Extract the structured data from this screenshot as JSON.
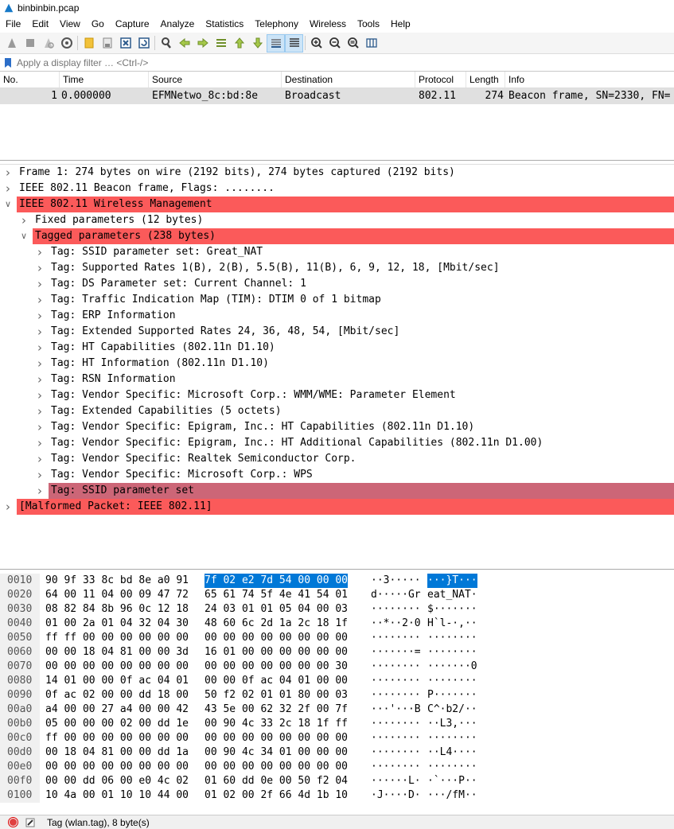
{
  "window": {
    "title": "binbinbin.pcap",
    "icon": "wireshark-fin-icon"
  },
  "menu": [
    "File",
    "Edit",
    "View",
    "Go",
    "Capture",
    "Analyze",
    "Statistics",
    "Telephony",
    "Wireless",
    "Tools",
    "Help"
  ],
  "toolbar_icons": [
    "start-capture-icon",
    "stop-capture-icon",
    "restart-capture-icon",
    "capture-options-icon",
    "open-file-icon",
    "save-file-icon",
    "close-file-icon",
    "reload-file-icon",
    "find-packet-icon",
    "go-back-icon",
    "go-forward-icon",
    "go-to-packet-icon",
    "go-first-icon",
    "go-last-icon",
    "autoscroll-icon",
    "colorize-icon",
    "zoom-in-icon",
    "zoom-out-icon",
    "zoom-normal-icon",
    "resize-columns-icon"
  ],
  "filter": {
    "placeholder": "Apply a display filter … <Ctrl-/>"
  },
  "packet_list": {
    "columns": [
      "No.",
      "Time",
      "Source",
      "Destination",
      "Protocol",
      "Length",
      "Info"
    ],
    "rows": [
      {
        "no": "1",
        "time": "0.000000",
        "source": "EFMNetwo_8c:bd:8e",
        "destination": "Broadcast",
        "protocol": "802.11",
        "length": "274",
        "info": "Beacon frame, SN=2330, FN="
      }
    ]
  },
  "details": [
    {
      "text": "Frame 1: 274 bytes on wire (2192 bits), 274 bytes captured (2192 bits)",
      "level": 0,
      "expanded": false,
      "style": "normal"
    },
    {
      "text": "IEEE 802.11 Beacon frame, Flags: ........",
      "level": 0,
      "expanded": false,
      "style": "normal"
    },
    {
      "text": "IEEE 802.11 Wireless Management",
      "level": 0,
      "expanded": true,
      "style": "red"
    },
    {
      "text": "Fixed parameters (12 bytes)",
      "level": 1,
      "expanded": false,
      "style": "normal"
    },
    {
      "text": "Tagged parameters (238 bytes)",
      "level": 1,
      "expanded": true,
      "style": "red"
    },
    {
      "text": "Tag: SSID parameter set: Great_NAT",
      "level": 2,
      "expanded": false,
      "style": "normal"
    },
    {
      "text": "Tag: Supported Rates 1(B), 2(B), 5.5(B), 11(B), 6, 9, 12, 18, [Mbit/sec]",
      "level": 2,
      "expanded": false,
      "style": "normal"
    },
    {
      "text": "Tag: DS Parameter set: Current Channel: 1",
      "level": 2,
      "expanded": false,
      "style": "normal"
    },
    {
      "text": "Tag: Traffic Indication Map (TIM): DTIM 0 of 1 bitmap",
      "level": 2,
      "expanded": false,
      "style": "normal"
    },
    {
      "text": "Tag: ERP Information",
      "level": 2,
      "expanded": false,
      "style": "normal"
    },
    {
      "text": "Tag: Extended Supported Rates 24, 36, 48, 54, [Mbit/sec]",
      "level": 2,
      "expanded": false,
      "style": "normal"
    },
    {
      "text": "Tag: HT Capabilities (802.11n D1.10)",
      "level": 2,
      "expanded": false,
      "style": "normal"
    },
    {
      "text": "Tag: HT Information (802.11n D1.10)",
      "level": 2,
      "expanded": false,
      "style": "normal"
    },
    {
      "text": "Tag: RSN Information",
      "level": 2,
      "expanded": false,
      "style": "normal"
    },
    {
      "text": "Tag: Vendor Specific: Microsoft Corp.: WMM/WME: Parameter Element",
      "level": 2,
      "expanded": false,
      "style": "normal"
    },
    {
      "text": "Tag: Extended Capabilities (5 octets)",
      "level": 2,
      "expanded": false,
      "style": "normal"
    },
    {
      "text": "Tag: Vendor Specific: Epigram, Inc.: HT Capabilities (802.11n D1.10)",
      "level": 2,
      "expanded": false,
      "style": "normal"
    },
    {
      "text": "Tag: Vendor Specific: Epigram, Inc.: HT Additional Capabilities (802.11n D1.00)",
      "level": 2,
      "expanded": false,
      "style": "normal"
    },
    {
      "text": "Tag: Vendor Specific: Realtek Semiconductor Corp.",
      "level": 2,
      "expanded": false,
      "style": "normal"
    },
    {
      "text": "Tag: Vendor Specific: Microsoft Corp.: WPS",
      "level": 2,
      "expanded": false,
      "style": "normal"
    },
    {
      "text": "Tag: SSID parameter set",
      "level": 2,
      "expanded": false,
      "style": "selected"
    },
    {
      "text": "[Malformed Packet: IEEE 802.11]",
      "level": 0,
      "expanded": false,
      "style": "red"
    }
  ],
  "hex_rows": [
    {
      "offset": "0010",
      "b1": "90 9f 33 8c bd 8e a0 91",
      "b2": "7f 02 e2 7d 54 00 00 00",
      "a1": "··3·····",
      "a2": "···}T···",
      "hl_b2": true
    },
    {
      "offset": "0020",
      "b1": "64 00 11 04 00 09 47 72",
      "b2": "65 61 74 5f 4e 41 54 01",
      "a1": "d·····Gr",
      "a2": "eat_NAT·"
    },
    {
      "offset": "0030",
      "b1": "08 82 84 8b 96 0c 12 18",
      "b2": "24 03 01 01 05 04 00 03",
      "a1": "········",
      "a2": "$·······"
    },
    {
      "offset": "0040",
      "b1": "01 00 2a 01 04 32 04 30",
      "b2": "48 60 6c 2d 1a 2c 18 1f",
      "a1": "··*··2·0",
      "a2": "H`l-·,··"
    },
    {
      "offset": "0050",
      "b1": "ff ff 00 00 00 00 00 00",
      "b2": "00 00 00 00 00 00 00 00",
      "a1": "········",
      "a2": "········"
    },
    {
      "offset": "0060",
      "b1": "00 00 18 04 81 00 00 3d",
      "b2": "16 01 00 00 00 00 00 00",
      "a1": "·······=",
      "a2": "········"
    },
    {
      "offset": "0070",
      "b1": "00 00 00 00 00 00 00 00",
      "b2": "00 00 00 00 00 00 00 30",
      "a1": "········",
      "a2": "·······0"
    },
    {
      "offset": "0080",
      "b1": "14 01 00 00 0f ac 04 01",
      "b2": "00 00 0f ac 04 01 00 00",
      "a1": "········",
      "a2": "········"
    },
    {
      "offset": "0090",
      "b1": "0f ac 02 00 00 dd 18 00",
      "b2": "50 f2 02 01 01 80 00 03",
      "a1": "········",
      "a2": "P·······"
    },
    {
      "offset": "00a0",
      "b1": "a4 00 00 27 a4 00 00 42",
      "b2": "43 5e 00 62 32 2f 00 7f",
      "a1": "···'···B",
      "a2": "C^·b2/··"
    },
    {
      "offset": "00b0",
      "b1": "05 00 00 00 02 00 dd 1e",
      "b2": "00 90 4c 33 2c 18 1f ff",
      "a1": "········",
      "a2": "··L3,···"
    },
    {
      "offset": "00c0",
      "b1": "ff 00 00 00 00 00 00 00",
      "b2": "00 00 00 00 00 00 00 00",
      "a1": "········",
      "a2": "········"
    },
    {
      "offset": "00d0",
      "b1": "00 18 04 81 00 00 dd 1a",
      "b2": "00 90 4c 34 01 00 00 00",
      "a1": "········",
      "a2": "··L4····"
    },
    {
      "offset": "00e0",
      "b1": "00 00 00 00 00 00 00 00",
      "b2": "00 00 00 00 00 00 00 00",
      "a1": "········",
      "a2": "········"
    },
    {
      "offset": "00f0",
      "b1": "00 00 dd 06 00 e0 4c 02",
      "b2": "01 60 dd 0e 00 50 f2 04",
      "a1": "······L·",
      "a2": "·`···P··"
    },
    {
      "offset": "0100",
      "b1": "10 4a 00 01 10 10 44 00",
      "b2": "01 02 00 2f 66 4d 1b 10",
      "a1": "·J····D·",
      "a2": "···/fM··"
    }
  ],
  "status": {
    "text": "Tag (wlan.tag), 8 byte(s)"
  },
  "colors": {
    "red_row": "#fb5a5a",
    "selected_row": "#cc6677",
    "hex_highlight": "#0078d7"
  }
}
